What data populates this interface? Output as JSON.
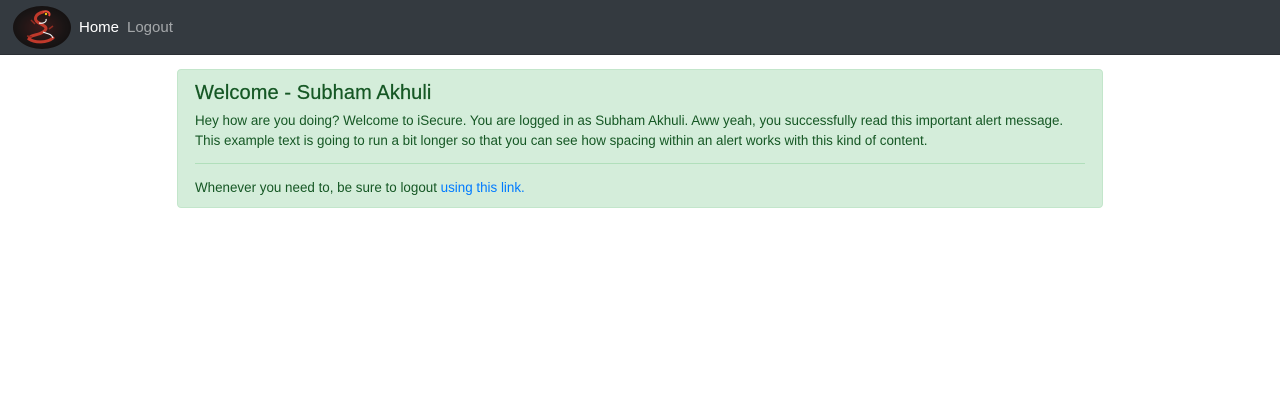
{
  "navbar": {
    "logo_icon": "dragon-logo-icon",
    "home_label": "Home",
    "logout_label": "Logout",
    "background": "#343a40"
  },
  "alert": {
    "heading": "Welcome - Subham Akhuli",
    "body": "Hey how are you doing? Welcome to iSecure. You are logged in as Subham Akhuli. Aww yeah, you successfully read this important alert message. This example text is going to run a bit longer so that you can see how spacing within an alert works with this kind of content.",
    "footer_text": "Whenever you need to, be sure to logout ",
    "footer_link": "using this link.",
    "background": "#d4edda",
    "text_color": "#155724",
    "link_color": "#007bff"
  }
}
